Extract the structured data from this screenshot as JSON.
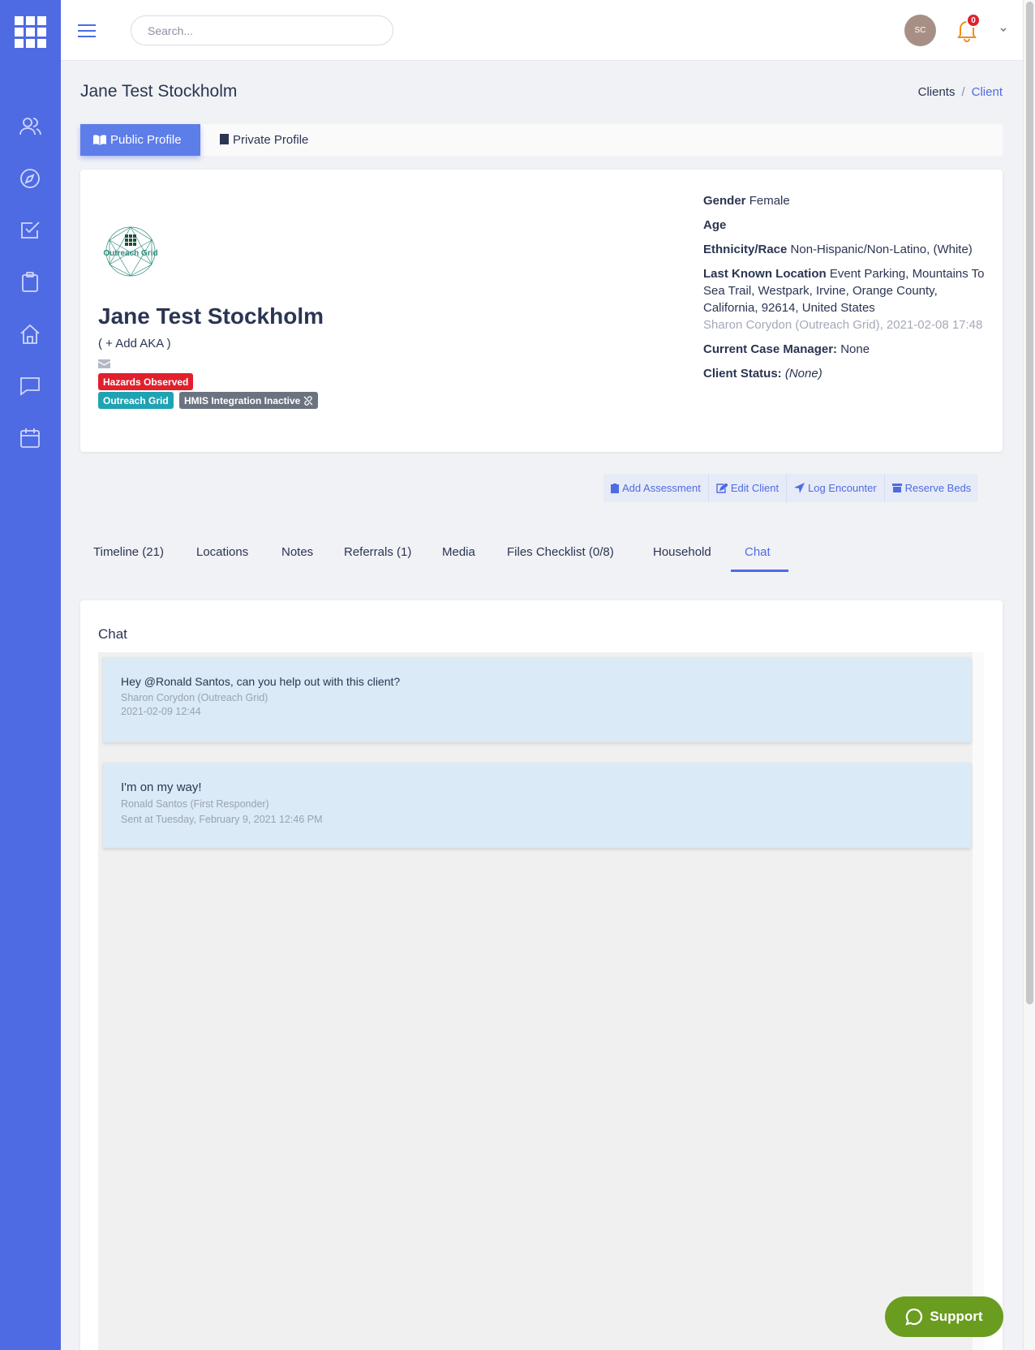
{
  "colors": {
    "brand": "#4f6be3",
    "danger": "#e0202c",
    "teal": "#1fa3b3",
    "support_green": "#6a9c1f"
  },
  "topbar": {
    "search_placeholder": "Search...",
    "avatar_initials": "SC",
    "notification_count": "0"
  },
  "sidebar": {
    "icons": [
      "users-icon",
      "compass-icon",
      "checkbox-icon",
      "clipboard-icon",
      "home-icon",
      "chat-icon",
      "calendar-icon"
    ]
  },
  "page": {
    "title": "Jane Test Stockholm",
    "breadcrumb": {
      "link": "Clients",
      "separator": "/",
      "active": "Client"
    }
  },
  "profile_tabs": {
    "public": "Public Profile",
    "private": "Private Profile"
  },
  "client": {
    "name": "Jane Test Stockholm",
    "add_aka": "( + Add AKA )",
    "logo_text": "Outreach Grid",
    "badges": {
      "hazard": "Hazards Observed",
      "org": "Outreach Grid",
      "hmis": "HMIS Integration Inactive"
    },
    "gender_label": "Gender",
    "gender": "Female",
    "age_label": "Age",
    "ethnicity_label": "Ethnicity/Race",
    "ethnicity": "Non-Hispanic/Non-Latino, (White)",
    "location_label": "Last Known Location",
    "location": "Event Parking, Mountains To Sea Trail, Westpark, Irvine, Orange County, California, 92614, United States",
    "location_source": "Sharon Corydon (Outreach Grid), 2021-02-08 17:48",
    "case_manager_label": "Current Case Manager:",
    "case_manager": "None",
    "status_label": "Client Status:",
    "status": "(None)"
  },
  "actions": {
    "add_assessment": "Add Assessment",
    "edit_client": "Edit Client",
    "log_encounter": "Log Encounter",
    "reserve_beds": "Reserve Beds"
  },
  "tabs": [
    "Timeline (21)",
    "Locations",
    "Notes",
    "Referrals (1)",
    "Media",
    "Files Checklist (0/8)",
    "Household",
    "Chat"
  ],
  "chat": {
    "title": "Chat",
    "messages": [
      {
        "text": "Hey @Ronald Santos, can you help out with this client?",
        "author": "Sharon Corydon (Outreach Grid)",
        "time": "2021-02-09 12:44"
      },
      {
        "text": "I'm on my way!",
        "author": "Ronald Santos (First Responder)",
        "time": "Sent at Tuesday, February 9, 2021 12:46 PM"
      }
    ]
  },
  "support": {
    "label": "Support"
  }
}
